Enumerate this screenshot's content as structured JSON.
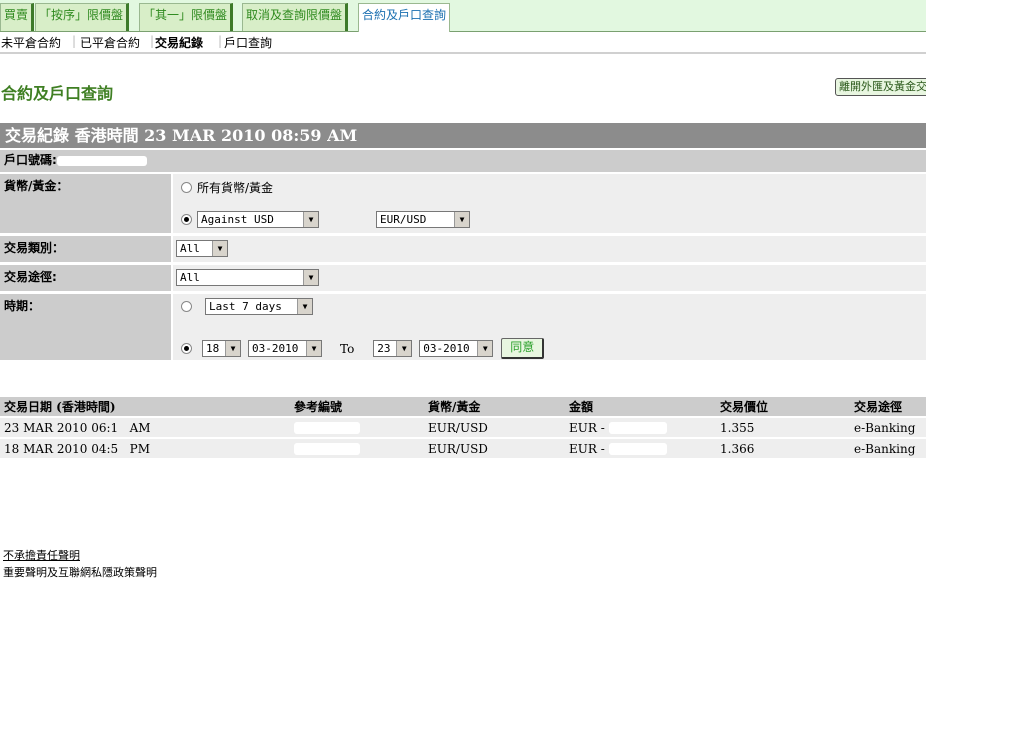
{
  "tabs": [
    "買賣",
    "「按序」限價盤",
    "「其一」限價盤",
    "取消及查詢限價盤",
    "合約及戶口查詢"
  ],
  "subnav": [
    "未平倉合約",
    "已平倉合約",
    "交易紀錄",
    "戶口查詢"
  ],
  "heading": "合約及戶口查詢",
  "exit_button": "離開外匯及黃金交易",
  "title": "交易紀錄  香港時間 23 MAR 2010 08:59 AM",
  "account_label": "戶口號碼:",
  "form": {
    "currency_label": "貨幣/黃金：",
    "all_currency": "所有貨幣/黃金",
    "against": "Against USD",
    "pair": "EUR/USD",
    "type_label": "交易類別：",
    "type": "All",
    "channel_label": "交易途徑:",
    "channel": "All",
    "period_label": "時期：",
    "period": "Last 7 days",
    "from_day": "18",
    "from_month": "03-2010",
    "to": "To",
    "to_day": "23",
    "to_month": "03-2010",
    "submit": "同意"
  },
  "results": {
    "headers": [
      "交易日期 (香港時間)",
      "參考編號",
      "貨幣/黃金",
      "金額",
      "交易價位",
      "交易途徑"
    ],
    "rows": [
      {
        "date": "23 MAR 2010 06:1   AM",
        "ref": "",
        "ccy": "EUR/USD",
        "amount": "EUR - ",
        "price": "1.355",
        "channel": "e-Banking"
      },
      {
        "date": "18 MAR 2010 04:5   PM",
        "ref": "",
        "ccy": "EUR/USD",
        "amount": "EUR - ",
        "price": "1.366",
        "channel": "e-Banking"
      }
    ]
  },
  "footer": {
    "disclaimer": "不承擔責任聲明",
    "privacy": "重要聲明及互聯網私隱政策聲明"
  }
}
